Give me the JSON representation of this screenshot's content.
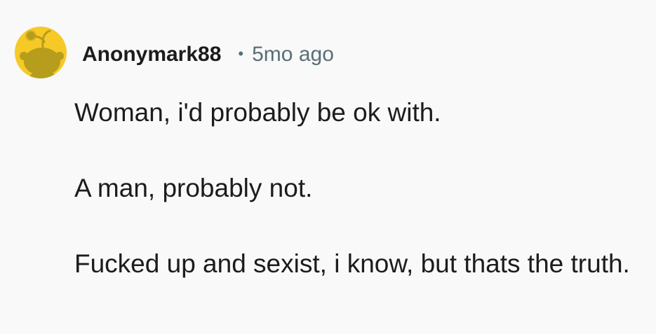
{
  "comment": {
    "author": "Anonymark88",
    "separator": "•",
    "timestamp": "5mo ago",
    "avatar_icon": "snoo-avatar-icon",
    "avatar_color": "#f6c927",
    "paragraphs": [
      "Woman, i'd probably be ok with.",
      "A man, probably not.",
      "Fucked up and sexist, i know, but thats the truth."
    ]
  }
}
